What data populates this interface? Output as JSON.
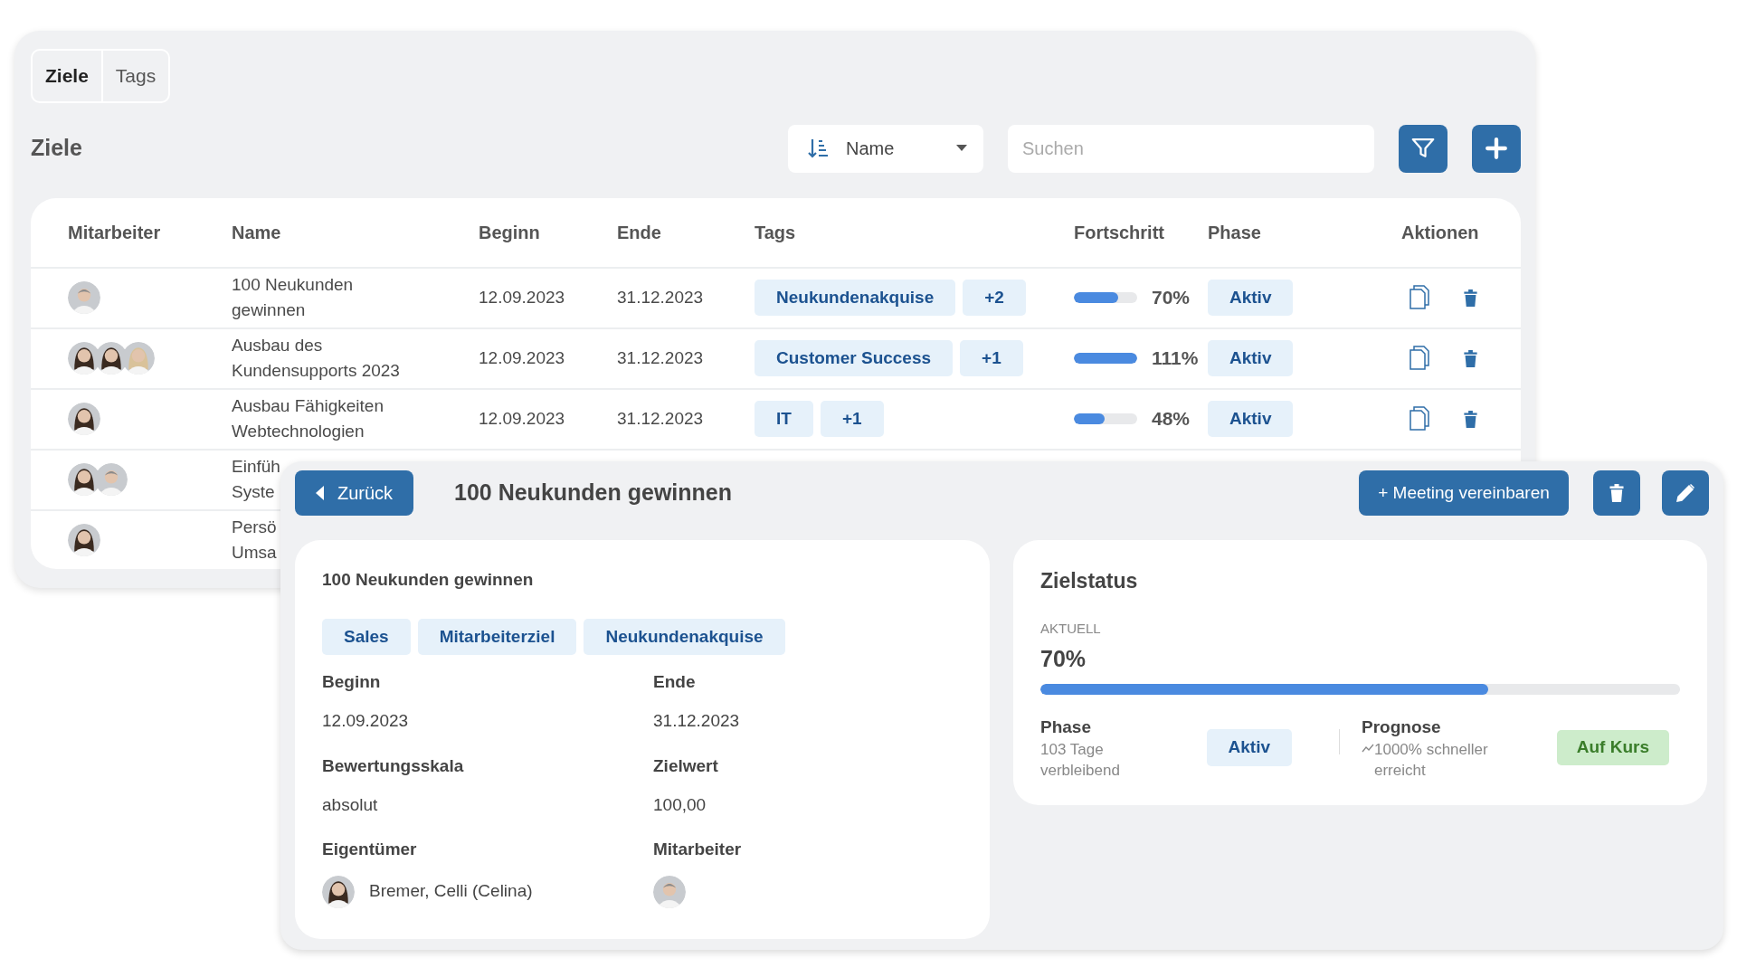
{
  "tabs": [
    {
      "label": "Ziele",
      "selected": true
    },
    {
      "label": "Tags",
      "selected": false
    }
  ],
  "title": "Ziele",
  "sort": {
    "label": "Name"
  },
  "search": {
    "placeholder": "Suchen"
  },
  "table": {
    "columns": [
      "Mitarbeiter",
      "Name",
      "Beginn",
      "Ende",
      "Tags",
      "Fortschritt",
      "Phase",
      "Aktionen"
    ],
    "rows": [
      {
        "employees": [
          {
            "kind": "man"
          }
        ],
        "name": "100 Neukunden\ngewinnen",
        "begin": "12.09.2023",
        "end": "31.12.2023",
        "tags": [
          "Neukundenakquise",
          "+2"
        ],
        "progress": {
          "level": 0.7,
          "reading": "70%"
        },
        "phase": "Aktiv"
      },
      {
        "employees": [
          {
            "kind": "woman"
          },
          {
            "kind": "woman"
          },
          {
            "kind": "blonde"
          }
        ],
        "name": "Ausbau des\nKundensupports 2023",
        "begin": "12.09.2023",
        "end": "31.12.2023",
        "tags": [
          "Customer Success",
          "+1"
        ],
        "progress": {
          "level": 1.0,
          "reading": "111%"
        },
        "phase": "Aktiv"
      },
      {
        "employees": [
          {
            "kind": "woman"
          }
        ],
        "name": "Ausbau Fähigkeiten\nWebtechnologien",
        "begin": "12.09.2023",
        "end": "31.12.2023",
        "tags": [
          "IT",
          "+1"
        ],
        "progress": {
          "level": 0.48,
          "reading": "48%"
        },
        "phase": "Aktiv"
      },
      {
        "employees": [
          {
            "kind": "woman"
          },
          {
            "kind": "man"
          }
        ],
        "name": "Einfüh\nSyste"
      },
      {
        "employees": [
          {
            "kind": "woman"
          }
        ],
        "name": "Persö\nUmsa"
      }
    ]
  },
  "detail": {
    "back": "Zurück",
    "title": "100 Neukunden gewinnen",
    "meeting": "+ Meeting vereinbaren",
    "card": {
      "title": "100 Neukunden gewinnen",
      "tags": [
        "Sales",
        "Mitarbeiterziel",
        "Neukundenakquise"
      ],
      "fields": [
        {
          "kind": "text",
          "label": "Beginn",
          "value": "12.09.2023"
        },
        {
          "kind": "text",
          "label": "Ende",
          "value": "31.12.2023"
        },
        {
          "kind": "text",
          "label": "Bewertungsskala",
          "value": "absolut"
        },
        {
          "kind": "text",
          "label": "Zielwert",
          "value": "100,00"
        },
        {
          "kind": "person",
          "label": "Eigentümer",
          "value": "Bremer, Celli (Celina)",
          "people": [
            {
              "kind": "woman"
            }
          ]
        },
        {
          "kind": "avatar",
          "label": "Mitarbeiter",
          "people": [
            {
              "kind": "man"
            }
          ]
        }
      ]
    },
    "status": {
      "title": "Zielstatus",
      "caption": "AKTUELL",
      "reading": "70%",
      "level": 0.7,
      "phase": {
        "label": "Phase",
        "text": "103 Tage\nverbleibend",
        "badge": "Aktiv"
      },
      "forecast": {
        "label": "Prognose",
        "text": "1000% schneller\nerreicht",
        "badge": "Auf Kurs"
      }
    }
  }
}
